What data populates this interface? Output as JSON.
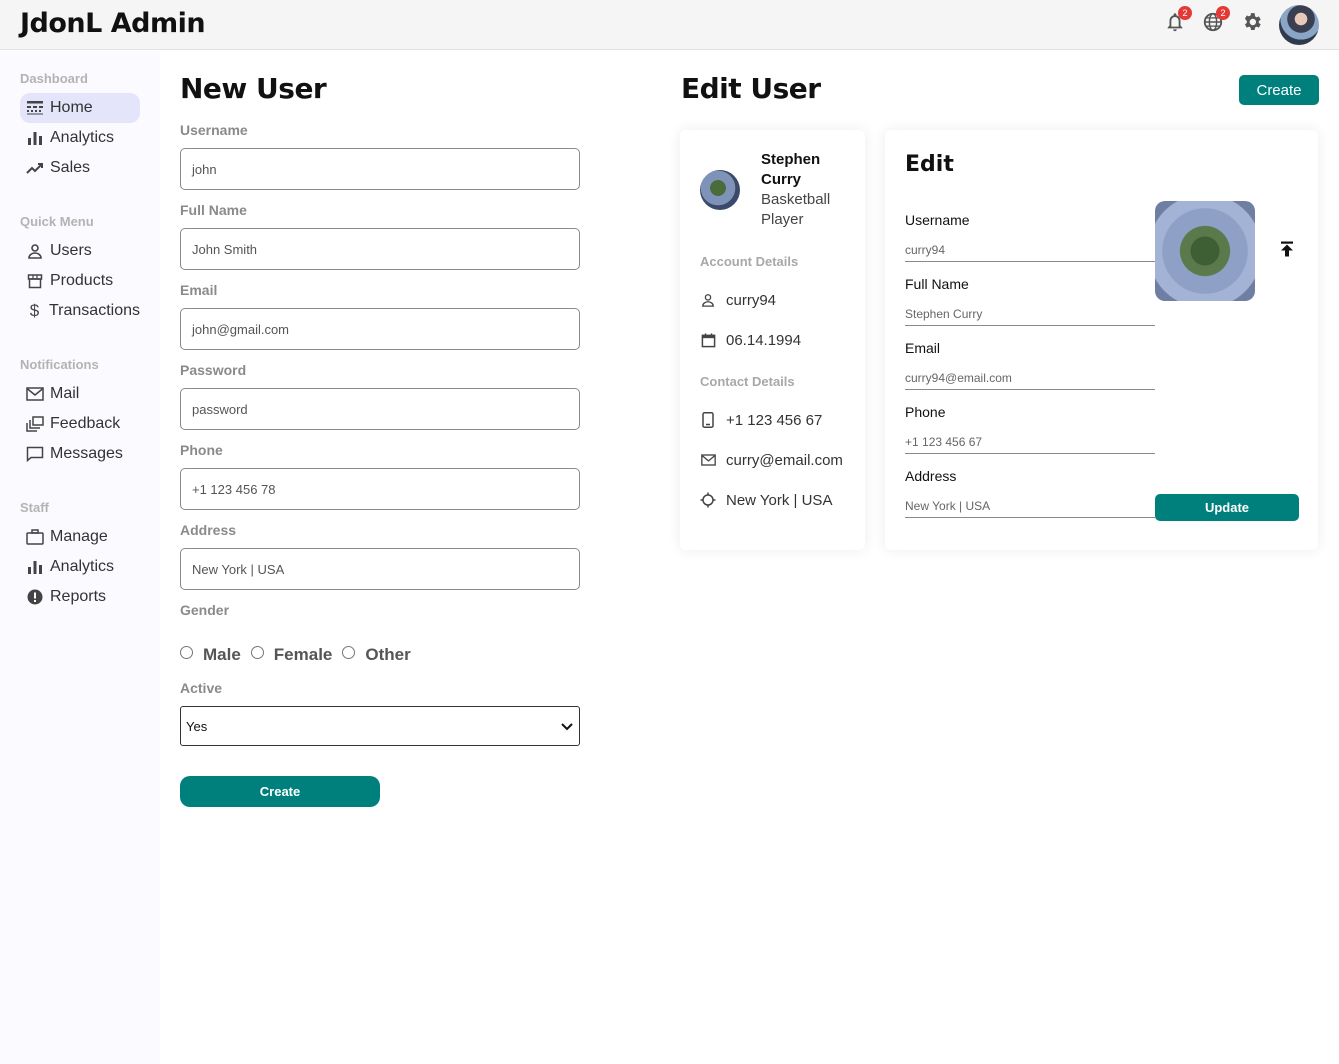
{
  "topbar": {
    "logo": "JdonL Admin",
    "notifications_badge": "2",
    "language_badge": "2",
    "icons": [
      "bell-icon",
      "globe-icon",
      "gear-icon"
    ]
  },
  "sidebar": {
    "sections": [
      {
        "title": "Dashboard",
        "items": [
          {
            "label": "Home",
            "icon": "line-style-icon",
            "active": true
          },
          {
            "label": "Analytics",
            "icon": "bar-chart-icon"
          },
          {
            "label": "Sales",
            "icon": "trending-up-icon"
          }
        ]
      },
      {
        "title": "Quick Menu",
        "items": [
          {
            "label": "Users",
            "icon": "person-icon"
          },
          {
            "label": "Products",
            "icon": "storefront-icon"
          },
          {
            "label": "Transactions",
            "icon": "dollar-icon"
          }
        ]
      },
      {
        "title": "Notifications",
        "items": [
          {
            "label": "Mail",
            "icon": "mail-icon"
          },
          {
            "label": "Feedback",
            "icon": "dynamic-feed-icon"
          },
          {
            "label": "Messages",
            "icon": "chat-bubble-icon"
          }
        ]
      },
      {
        "title": "Staff",
        "items": [
          {
            "label": "Manage",
            "icon": "work-icon"
          },
          {
            "label": "Analytics",
            "icon": "bar-chart-icon"
          },
          {
            "label": "Reports",
            "icon": "report-icon"
          }
        ]
      }
    ]
  },
  "new_user": {
    "title": "New User",
    "fields": [
      {
        "label": "Username",
        "value": "john"
      },
      {
        "label": "Full Name",
        "value": "John Smith"
      },
      {
        "label": "Email",
        "value": "john@gmail.com"
      },
      {
        "label": "Password",
        "value": "password"
      },
      {
        "label": "Phone",
        "value": "+1 123 456 78"
      },
      {
        "label": "Address",
        "value": "New York | USA"
      }
    ],
    "gender_label": "Gender",
    "gender_options": [
      "Male",
      "Female",
      "Other"
    ],
    "active_label": "Active",
    "active_value": "Yes",
    "create_label": "Create"
  },
  "edit_user": {
    "title": "Edit User",
    "create_label": "Create",
    "show": {
      "name": "Stephen Curry",
      "title": "Basketball Player",
      "account_details_label": "Account Details",
      "username": "curry94",
      "birthday": "06.14.1994",
      "contact_details_label": "Contact Details",
      "phone": "+1 123 456 67",
      "email": "curry@email.com",
      "address": "New York | USA"
    },
    "update": {
      "title": "Edit",
      "fields": [
        {
          "label": "Username",
          "placeholder": "curry94"
        },
        {
          "label": "Full Name",
          "placeholder": "Stephen Curry"
        },
        {
          "label": "Email",
          "placeholder": "curry94@email.com"
        },
        {
          "label": "Phone",
          "placeholder": "+1 123 456 67"
        },
        {
          "label": "Address",
          "placeholder": "New York | USA"
        }
      ],
      "update_label": "Update"
    }
  },
  "colors": {
    "accent": "#00807d",
    "badge": "#e53935",
    "sidebar_active": "#e4e4fa"
  }
}
